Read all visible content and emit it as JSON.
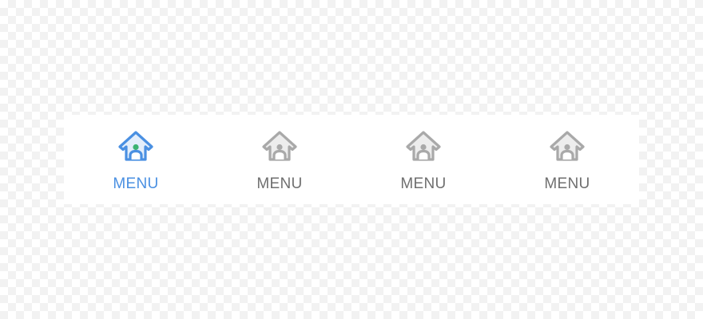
{
  "tabbar": {
    "active_index": 0,
    "colors": {
      "active_label": "#4a90e2",
      "active_icon_stroke": "#4a90e2",
      "active_icon_fill": "#e3eefb",
      "active_icon_dot": "#3cb371",
      "inactive_label": "#6f6f6f",
      "inactive_icon_stroke": "#a9a9a9",
      "inactive_icon_fill": "#ededed",
      "inactive_icon_dot": "#a9a9a9"
    },
    "tabs": [
      {
        "label": "MENU",
        "icon": "house-user-icon"
      },
      {
        "label": "MENU",
        "icon": "house-user-icon"
      },
      {
        "label": "MENU",
        "icon": "house-user-icon"
      },
      {
        "label": "MENU",
        "icon": "house-user-icon"
      }
    ]
  }
}
